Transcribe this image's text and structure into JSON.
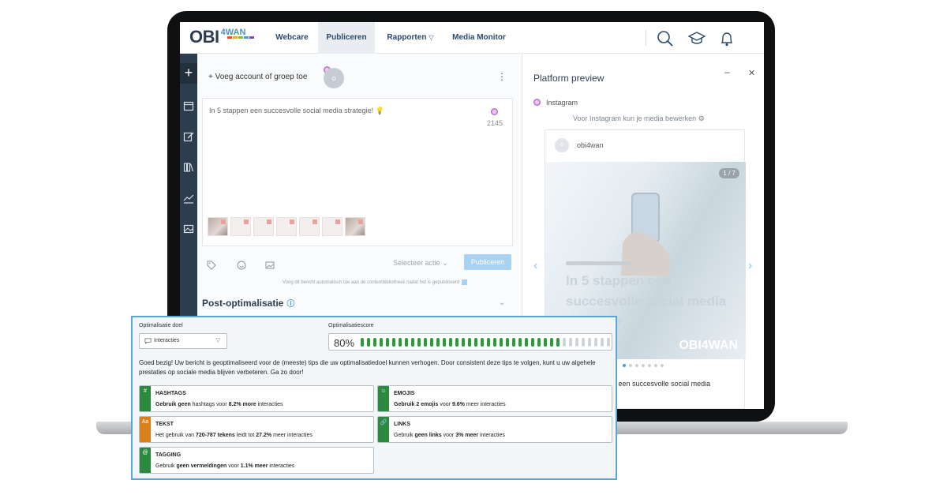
{
  "nav": {
    "logo_main": "OBI",
    "logo_sub": "4WAN",
    "items": [
      {
        "label": "Webcare"
      },
      {
        "label": "Publiceren"
      },
      {
        "label": "Rapporten"
      },
      {
        "label": "Media Monitor"
      }
    ],
    "icons": [
      "search-icon",
      "graduation-cap-icon",
      "bell-icon"
    ]
  },
  "sidebar": {
    "icons": [
      "plus-icon",
      "calendar-icon",
      "edit-icon",
      "library-icon",
      "chart-icon",
      "image-icon"
    ]
  },
  "compose": {
    "add_account": "+ Voeg account of groep toe",
    "avatar_letter": "o",
    "kebab": "⋮",
    "text": "In 5 stappen een succesvolle social media strategie! 💡",
    "char_count": "2145",
    "select_action": "Selecteer actie",
    "publish": "Publiceren",
    "auto_note": "Voeg dit bericht automatisch toe aan de contentbibliotheek nadat het is gepubliceerd",
    "post_optimisation": "Post-optimalisatie"
  },
  "preview": {
    "title": "Platform preview",
    "platform": "Instagram",
    "note": "Voor Instagram kun je media bewerken",
    "handle": "obi4wan",
    "avatar_letter": "o",
    "counter": "1 / 7",
    "headline": "In 5 stappen een succesvolle social media strategie",
    "logo": "OBI4WAN",
    "caption": "ppen een succesvolle social media"
  },
  "optimisation": {
    "goal_label": "Optimalisatie doel",
    "goal_value": "Interacties",
    "score_label": "Optimalisatiescore",
    "score_text": "80%",
    "score_percent": 80,
    "score_ticks": 40,
    "message": "Goed bezig! Uw bericht is geoptimaliseerd voor de (meeste) tips die uw optimalisatiedoel kunnen verhogen. Door consistent deze tips te volgen, kunt u uw algehele prestaties op sociale media blijven verbeteren. Ga zo door!",
    "tips": [
      {
        "glyph": "#",
        "color": "#2b8a3e",
        "title": "HASHTAGS",
        "pre": "",
        "b1": "Gebruik geen",
        "mid": " hashtags voor ",
        "b2": "8.2% more",
        "post": " interacties"
      },
      {
        "glyph": "☺",
        "color": "#2b8a3e",
        "title": "EMOJIS",
        "pre": "",
        "b1": "Gebruik 2 emojis",
        "mid": " voor ",
        "b2": "9.6%",
        "post": " meer interacties"
      },
      {
        "glyph": "Aa",
        "color": "#d9801b",
        "title": "TEKST",
        "pre": "Het gebruik van ",
        "b1": "720-787 tekens",
        "mid": " leidt tot ",
        "b2": "27.2%",
        "post": " meer interacties"
      },
      {
        "glyph": "🔗",
        "color": "#2b8a3e",
        "title": "LINKS",
        "pre": "Gebruik ",
        "b1": "geen links",
        "mid": " voor ",
        "b2": "3% meer",
        "post": " interacties"
      },
      {
        "glyph": "@",
        "color": "#2b8a3e",
        "title": "TAGGING",
        "pre": "Gebruik ",
        "b1": "geen vermeldingen",
        "mid": " voor ",
        "b2": "1.1% meer",
        "post": " interacties"
      }
    ]
  }
}
